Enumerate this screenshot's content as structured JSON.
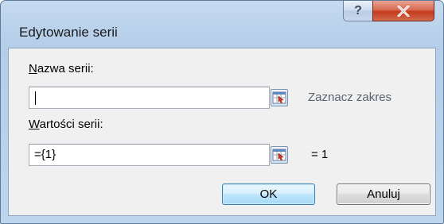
{
  "window": {
    "title": "Edytowanie serii",
    "help_glyph": "?",
    "close_glyph": "x"
  },
  "series_name": {
    "label_access": "N",
    "label_rest": "azwa serii:",
    "value": "",
    "hint": "Zaznacz zakres"
  },
  "series_values": {
    "label_access": "W",
    "label_rest": "artości serii:",
    "value": "={1}",
    "result": "= 1"
  },
  "buttons": {
    "ok_label": "OK",
    "cancel_label": "Anuluj"
  },
  "colors": {
    "hint_text": "#5a6270",
    "close_button": "#c53a1c",
    "ok_border": "#3c7fb1"
  },
  "icons": {
    "ref_button": "range-select-icon",
    "help": "question-mark-icon",
    "close": "close-icon"
  }
}
